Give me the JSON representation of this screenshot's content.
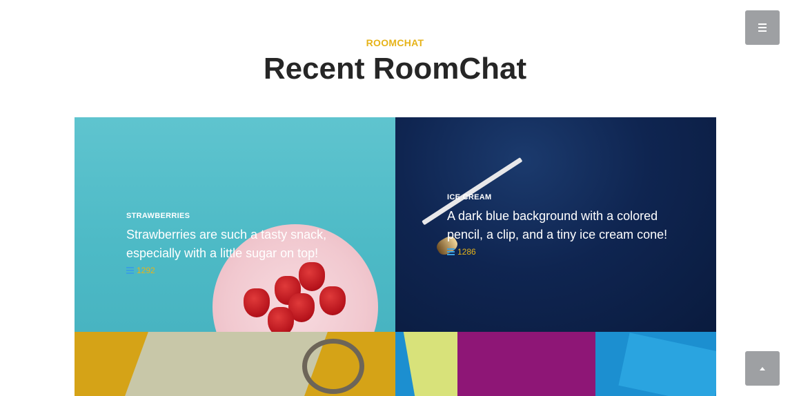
{
  "header": {
    "eyebrow": "ROOMCHAT",
    "title": "Recent RoomChat"
  },
  "cards": [
    {
      "category": "STRAWBERRIES",
      "title": "Strawberries are such a tasty snack, especially with a little sugar on top!",
      "count": "1292",
      "bg_color": "#4dbac6"
    },
    {
      "category": "ICE CREAM",
      "title": "A dark blue background with a colored pencil, a clip, and a tiny ice cream cone!",
      "count": "1286",
      "bg_color": "#0f2551"
    },
    {
      "bg_color": "#d5a317"
    },
    {
      "bg_color": "#1c8fd0"
    }
  ],
  "icons": {
    "menu": "menu-icon",
    "list": "list-icon",
    "scroll_top": "chevron-up-icon"
  },
  "colors": {
    "accent": "#e6b319",
    "heading": "#262626",
    "button": "#9ea0a3"
  }
}
